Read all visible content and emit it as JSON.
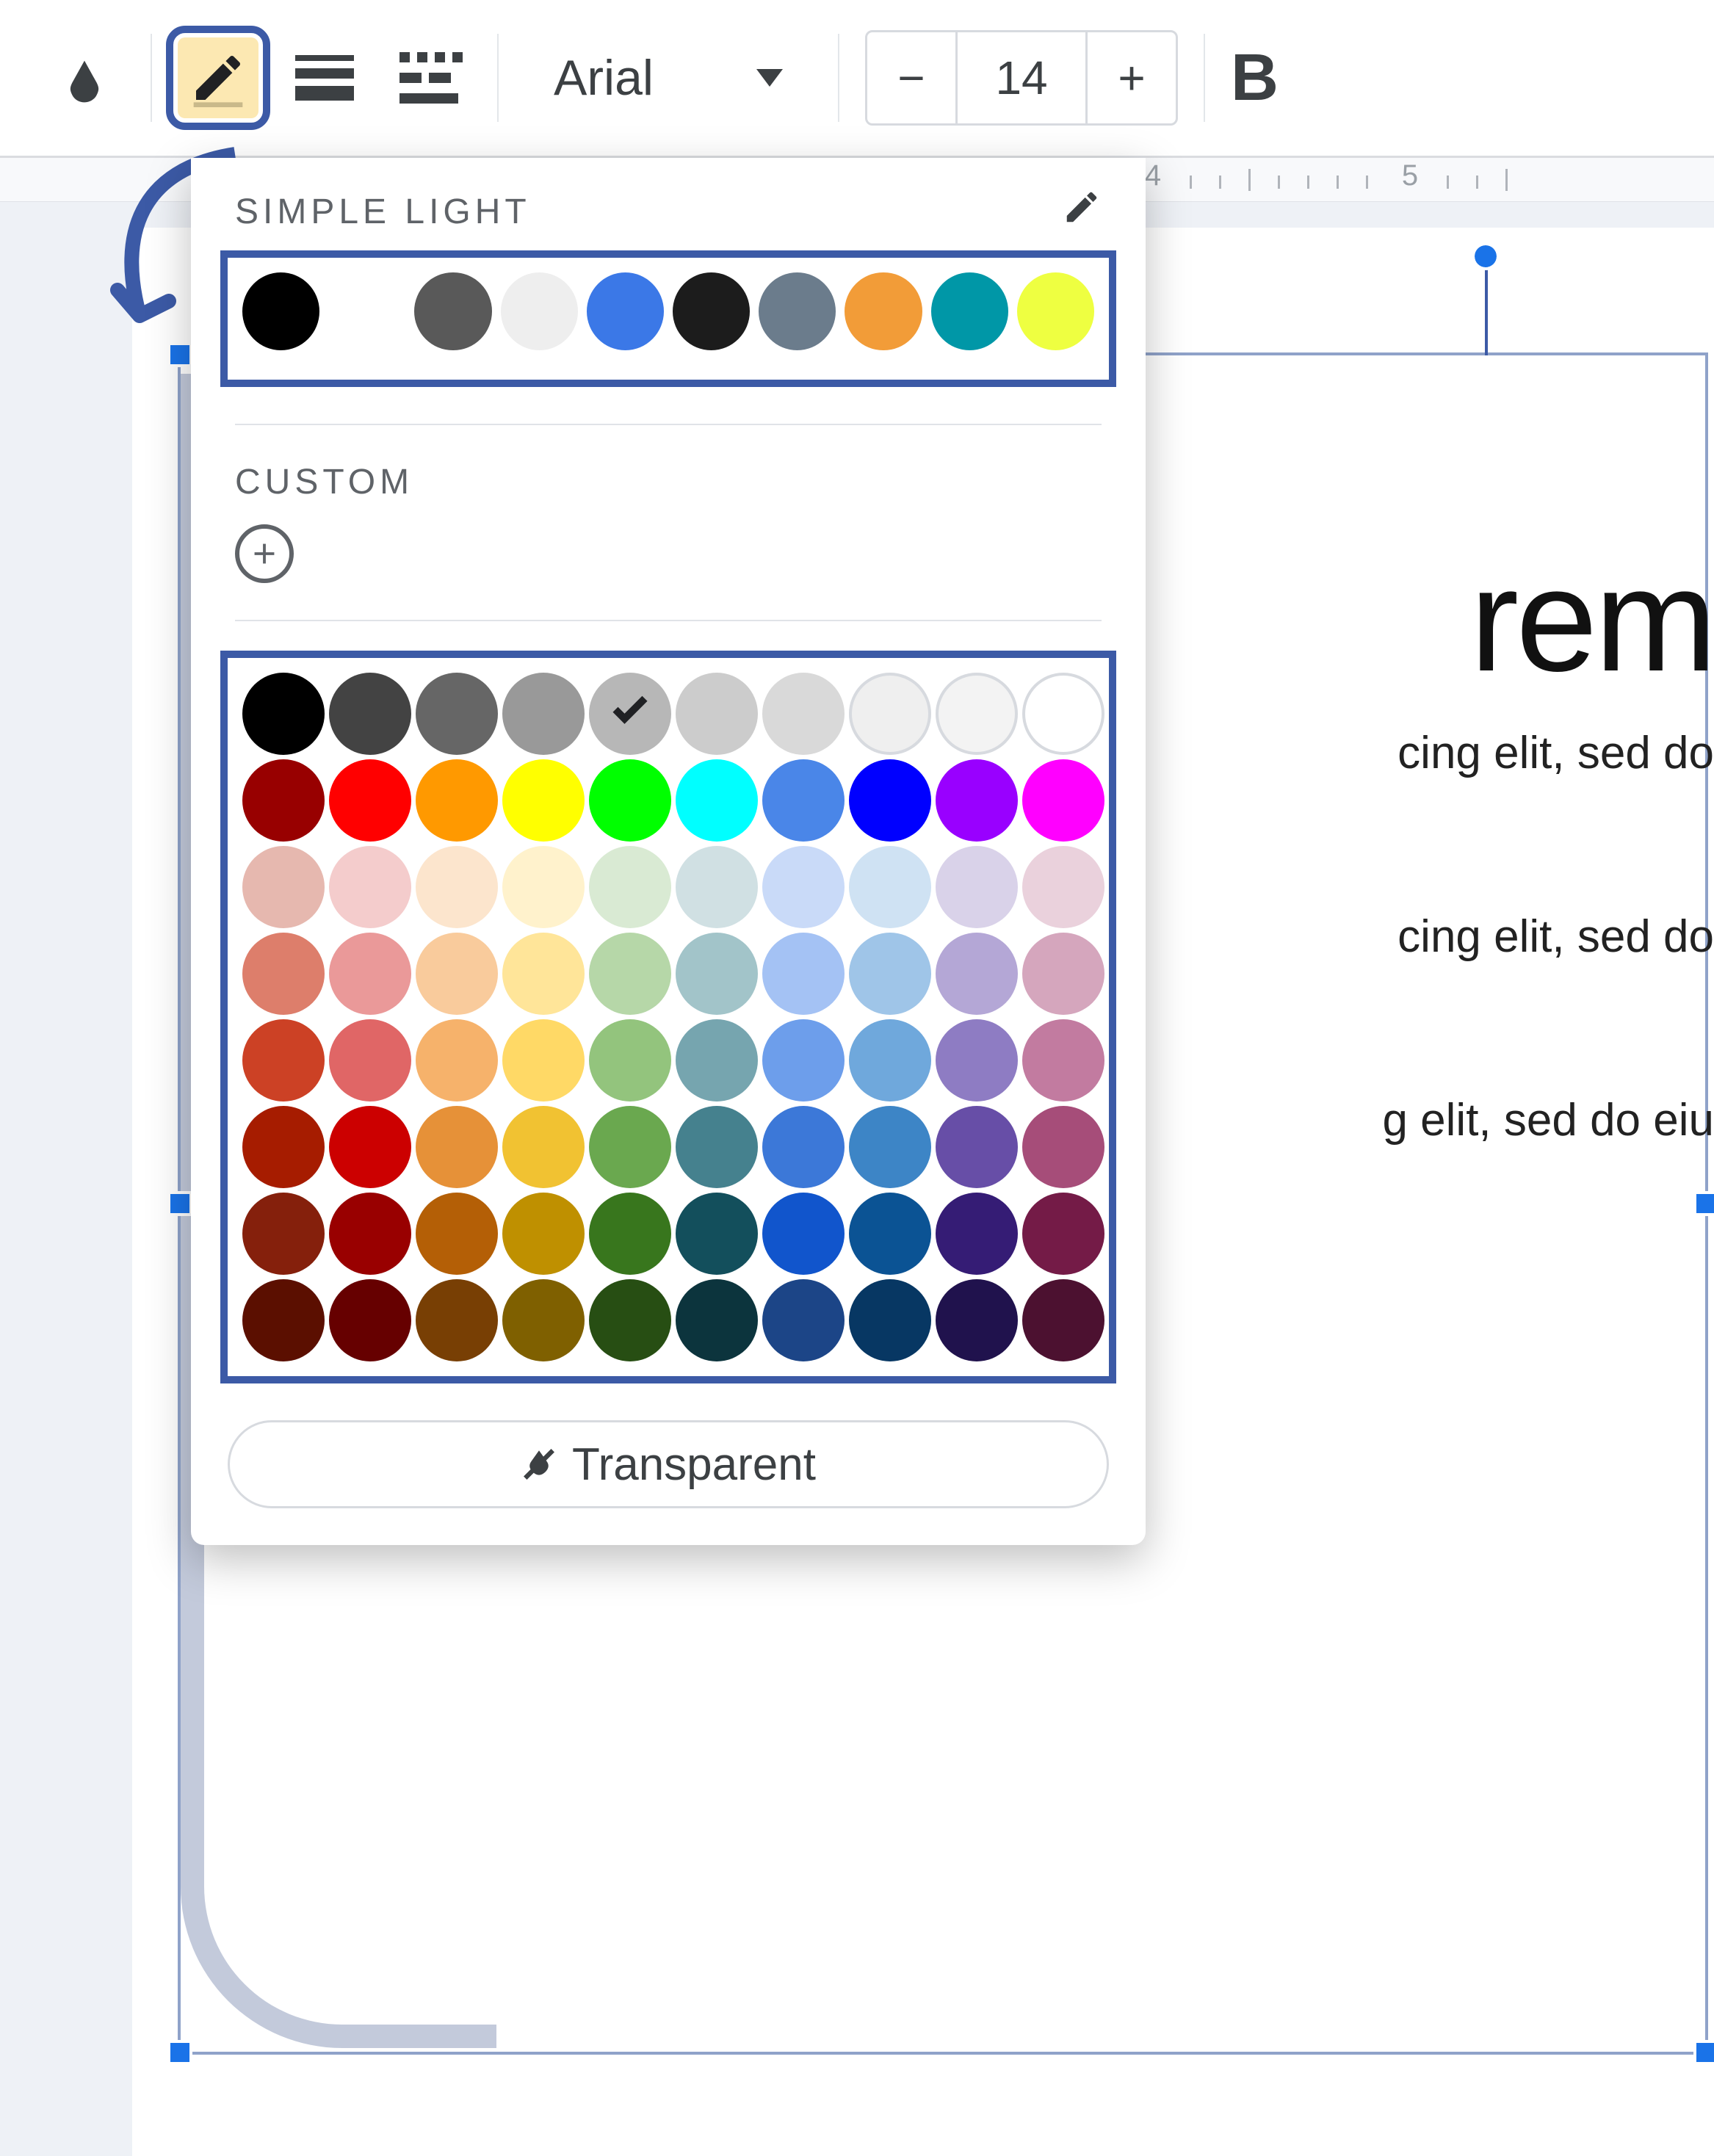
{
  "toolbar": {
    "font_name": "Arial",
    "font_size": "14",
    "decrease_label": "−",
    "increase_label": "+",
    "bold_label": "B"
  },
  "ruler": {
    "marks": [
      "4",
      "5"
    ]
  },
  "picker": {
    "theme_label": "SIMPLE LIGHT",
    "custom_label": "CUSTOM",
    "transparent_label": "Transparent",
    "theme_colors": [
      "#000000",
      "#ffffff",
      "#595959",
      "#eeeeee",
      "#3b78e7",
      "#1c1c1c",
      "#6b7c8c",
      "#f29c38",
      "#0097a7",
      "#eeff41"
    ],
    "selected_index": 4,
    "standard_colors": [
      [
        "#000000",
        "#434343",
        "#666666",
        "#999999",
        "#b7b7b7",
        "#cccccc",
        "#d9d9d9",
        "#efefef",
        "#f3f3f3",
        "#ffffff"
      ],
      [
        "#980000",
        "#ff0000",
        "#ff9900",
        "#ffff00",
        "#00ff00",
        "#00ffff",
        "#4a86e8",
        "#0000ff",
        "#9900ff",
        "#ff00ff"
      ],
      [
        "#e6b8af",
        "#f4cccc",
        "#fce5cd",
        "#fff2cc",
        "#d9ead3",
        "#d0e0e3",
        "#c9daf8",
        "#cfe2f3",
        "#d9d2e9",
        "#ead1dc"
      ],
      [
        "#dd7e6b",
        "#ea9999",
        "#f9cb9c",
        "#ffe599",
        "#b6d7a8",
        "#a2c4c9",
        "#a4c2f4",
        "#9fc5e8",
        "#b4a7d6",
        "#d5a6bd"
      ],
      [
        "#cc4125",
        "#e06666",
        "#f6b26b",
        "#ffd966",
        "#93c47d",
        "#76a5af",
        "#6d9eeb",
        "#6fa8dc",
        "#8e7cc3",
        "#c27ba0"
      ],
      [
        "#a61c00",
        "#cc0000",
        "#e69138",
        "#f1c232",
        "#6aa84f",
        "#45818e",
        "#3c78d8",
        "#3d85c6",
        "#674ea7",
        "#a64d79"
      ],
      [
        "#85200c",
        "#990000",
        "#b45f06",
        "#bf9000",
        "#38761d",
        "#134f5c",
        "#1155cc",
        "#0b5394",
        "#351c75",
        "#741b47"
      ],
      [
        "#5b0f00",
        "#660000",
        "#783f04",
        "#7f6000",
        "#274e13",
        "#0c343d",
        "#1c4587",
        "#073763",
        "#20124d",
        "#4c1130"
      ]
    ]
  },
  "slide": {
    "title_fragment": "rem",
    "line1": "cing elit, sed do",
    "line2": "cing elit, sed do",
    "line3": "g elit, sed do eiu"
  }
}
